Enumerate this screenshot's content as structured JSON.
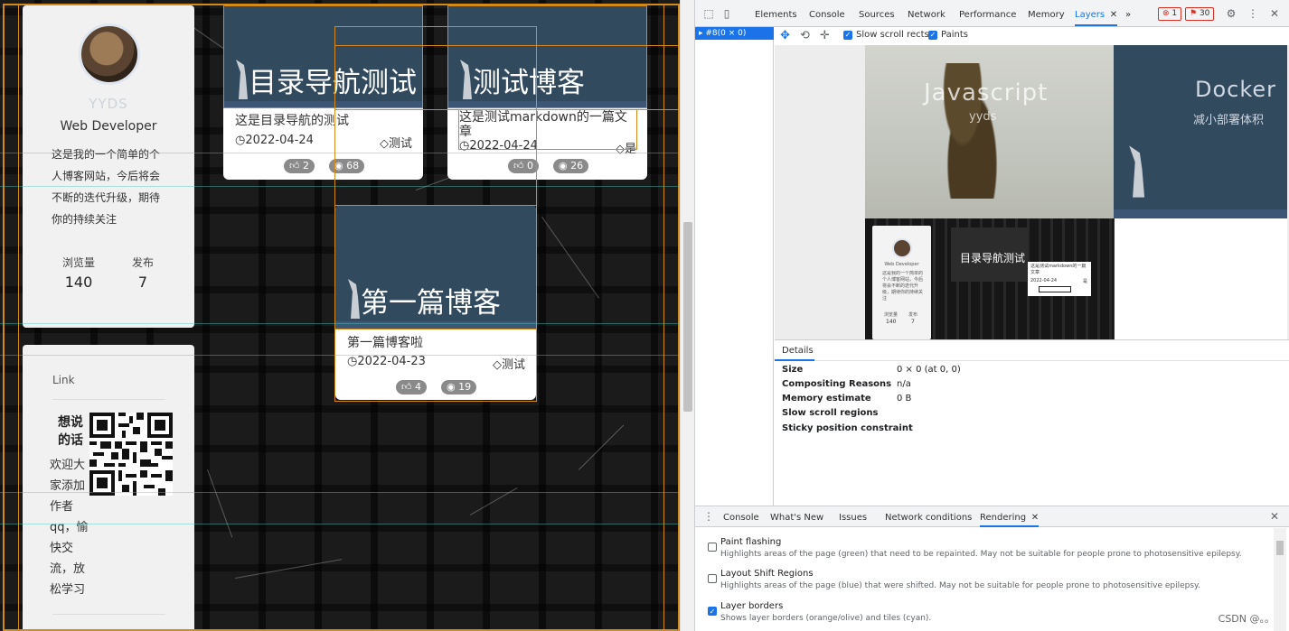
{
  "profile": {
    "username": "YYDS",
    "role": "Web Developer",
    "bio": "这是我的一个简单的个人博客网站，今后将会不断的迭代升级，期待你的持续关注",
    "stats": [
      {
        "label": "浏览量",
        "value": "140"
      },
      {
        "label": "发布",
        "value": "7"
      }
    ]
  },
  "link_card": {
    "title": "Link",
    "qr_caption": "想说的话",
    "text": "欢迎大家添加作者qq，愉快交流，放松学习"
  },
  "posts": [
    {
      "cover_title": "目录导航测试",
      "desc": "这是目录导航的测试",
      "date": "2022-04-24",
      "tag": "测试",
      "likes": "2",
      "views": "68"
    },
    {
      "cover_title": "测试博客",
      "desc": "这是测试markdown的一篇文章",
      "date": "2022-04-24",
      "tag": "是",
      "likes": "0",
      "views": "26"
    },
    {
      "cover_title": "第一篇博客",
      "desc": "第一篇博客啦",
      "date": "2022-04-23",
      "tag": "测试",
      "likes": "4",
      "views": "19"
    }
  ],
  "devtools": {
    "tabs": [
      "Elements",
      "Console",
      "Sources",
      "Network",
      "Performance",
      "Memory",
      "Layers"
    ],
    "active_tab": "Layers",
    "more_tabs": "»",
    "errors": "1",
    "warnings": "30",
    "layer_row": "#8(0 × 0)",
    "toolbar": {
      "slow_scroll": "Slow scroll rects",
      "paints": "Paints"
    },
    "thumbnails": {
      "js_title": "Javascript",
      "js_sub": "yyds",
      "docker_title": "Docker",
      "docker_sub": "减小部署体积",
      "card_title": "目录导航测试",
      "mini_role": "Web Developer",
      "mini_bio": "这是我的一个简单的个人博客网站，今后将会不断的迭代升级，期待你的持续关注",
      "mini_stat_labels": [
        "浏览量",
        "发布"
      ],
      "mini_stat_values": [
        "140",
        "7"
      ],
      "mini_card_desc": "这是测试markdown的一篇文章",
      "mini_card_date": "2022-04-24",
      "mini_card_tag": "是"
    },
    "details": {
      "tab": "Details",
      "rows": [
        {
          "key": "Size",
          "value": "0 × 0 (at 0, 0)"
        },
        {
          "key": "Compositing Reasons",
          "value": "n/a"
        },
        {
          "key": "Memory estimate",
          "value": "0 B"
        },
        {
          "key": "Slow scroll regions",
          "value": ""
        },
        {
          "key": "Sticky position constraint",
          "value": ""
        }
      ]
    },
    "drawer_tabs": [
      "Console",
      "What's New",
      "Issues",
      "Network conditions",
      "Rendering"
    ],
    "drawer_active": "Rendering",
    "rendering": [
      {
        "title": "Paint flashing",
        "desc": "Highlights areas of the page (green) that need to be repainted. May not be suitable for people prone to photosensitive epilepsy.",
        "checked": false
      },
      {
        "title": "Layout Shift Regions",
        "desc": "Highlights areas of the page (blue) that were shifted. May not be suitable for people prone to photosensitive epilepsy.",
        "checked": false
      },
      {
        "title": "Layer borders",
        "desc": "Shows layer borders (orange/olive) and tiles (cyan).",
        "checked": true
      }
    ],
    "watermark": "CSDN @。。0"
  },
  "colors": {
    "accent": "#1a73e8",
    "layer_border": "#d48a1a",
    "tile_border": "#50c8be",
    "cover": "#324a5e"
  },
  "icons": {
    "clock": "clock-icon",
    "tag": "tag-icon",
    "thumb": "thumbs-up-icon",
    "eye": "eye-icon"
  }
}
